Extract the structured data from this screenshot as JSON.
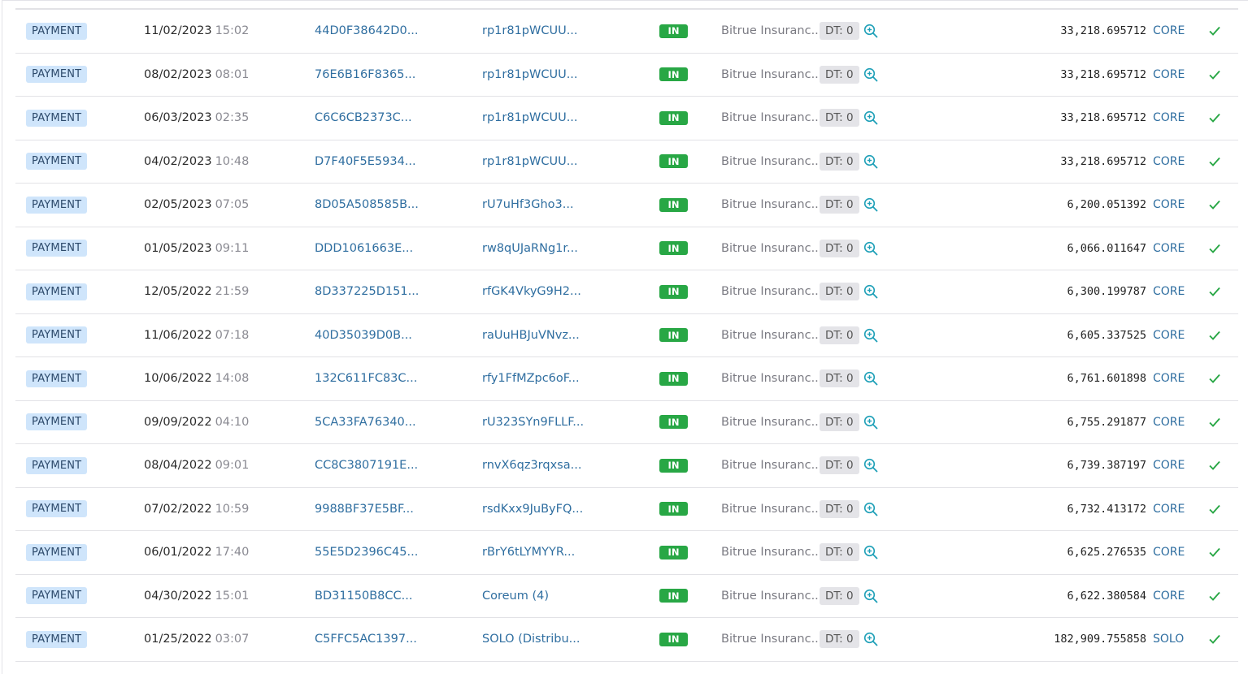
{
  "colors": {
    "type_badge_bg": "#cfe5fb",
    "link": "#2f6ea0",
    "in_badge": "#28a745",
    "dt_badge_bg": "#e4e4e8",
    "zoom_icon": "#1fa0b8",
    "check": "#28a745"
  },
  "rows": [
    {
      "type": "PAYMENT",
      "date": "11/02/2023",
      "time": "15:02",
      "hash": "44D0F38642D0...",
      "account": "rp1r81pWCUU...",
      "direction": "IN",
      "counterparty": "Bitrue Insuranc...",
      "dt": "DT: 0",
      "amount": "33,218.695712",
      "currency": "CORE",
      "status": "success"
    },
    {
      "type": "PAYMENT",
      "date": "08/02/2023",
      "time": "08:01",
      "hash": "76E6B16F8365...",
      "account": "rp1r81pWCUU...",
      "direction": "IN",
      "counterparty": "Bitrue Insuranc...",
      "dt": "DT: 0",
      "amount": "33,218.695712",
      "currency": "CORE",
      "status": "success"
    },
    {
      "type": "PAYMENT",
      "date": "06/03/2023",
      "time": "02:35",
      "hash": "C6C6CB2373C...",
      "account": "rp1r81pWCUU...",
      "direction": "IN",
      "counterparty": "Bitrue Insuranc...",
      "dt": "DT: 0",
      "amount": "33,218.695712",
      "currency": "CORE",
      "status": "success"
    },
    {
      "type": "PAYMENT",
      "date": "04/02/2023",
      "time": "10:48",
      "hash": "D7F40F5E5934...",
      "account": "rp1r81pWCUU...",
      "direction": "IN",
      "counterparty": "Bitrue Insuranc...",
      "dt": "DT: 0",
      "amount": "33,218.695712",
      "currency": "CORE",
      "status": "success"
    },
    {
      "type": "PAYMENT",
      "date": "02/05/2023",
      "time": "07:05",
      "hash": "8D05A508585B...",
      "account": "rU7uHf3Gho3...",
      "direction": "IN",
      "counterparty": "Bitrue Insuranc...",
      "dt": "DT: 0",
      "amount": "6,200.051392",
      "currency": "CORE",
      "status": "success"
    },
    {
      "type": "PAYMENT",
      "date": "01/05/2023",
      "time": "09:11",
      "hash": "DDD1061663E...",
      "account": "rw8qUJaRNg1r...",
      "direction": "IN",
      "counterparty": "Bitrue Insuranc...",
      "dt": "DT: 0",
      "amount": "6,066.011647",
      "currency": "CORE",
      "status": "success"
    },
    {
      "type": "PAYMENT",
      "date": "12/05/2022",
      "time": "21:59",
      "hash": "8D337225D151...",
      "account": "rfGK4VkyG9H2...",
      "direction": "IN",
      "counterparty": "Bitrue Insuranc...",
      "dt": "DT: 0",
      "amount": "6,300.199787",
      "currency": "CORE",
      "status": "success"
    },
    {
      "type": "PAYMENT",
      "date": "11/06/2022",
      "time": "07:18",
      "hash": "40D35039D0B...",
      "account": "raUuHBJuVNvz...",
      "direction": "IN",
      "counterparty": "Bitrue Insuranc...",
      "dt": "DT: 0",
      "amount": "6,605.337525",
      "currency": "CORE",
      "status": "success"
    },
    {
      "type": "PAYMENT",
      "date": "10/06/2022",
      "time": "14:08",
      "hash": "132C611FC83C...",
      "account": "rfy1FfMZpc6oF...",
      "direction": "IN",
      "counterparty": "Bitrue Insuranc...",
      "dt": "DT: 0",
      "amount": "6,761.601898",
      "currency": "CORE",
      "status": "success"
    },
    {
      "type": "PAYMENT",
      "date": "09/09/2022",
      "time": "04:10",
      "hash": "5CA33FA76340...",
      "account": "rU323SYn9FLLF...",
      "direction": "IN",
      "counterparty": "Bitrue Insuranc...",
      "dt": "DT: 0",
      "amount": "6,755.291877",
      "currency": "CORE",
      "status": "success"
    },
    {
      "type": "PAYMENT",
      "date": "08/04/2022",
      "time": "09:01",
      "hash": "CC8C3807191E...",
      "account": "rnvX6qz3rqxsa...",
      "direction": "IN",
      "counterparty": "Bitrue Insuranc...",
      "dt": "DT: 0",
      "amount": "6,739.387197",
      "currency": "CORE",
      "status": "success"
    },
    {
      "type": "PAYMENT",
      "date": "07/02/2022",
      "time": "10:59",
      "hash": "9988BF37E5BF...",
      "account": "rsdKxx9JuByFQ...",
      "direction": "IN",
      "counterparty": "Bitrue Insuranc...",
      "dt": "DT: 0",
      "amount": "6,732.413172",
      "currency": "CORE",
      "status": "success"
    },
    {
      "type": "PAYMENT",
      "date": "06/01/2022",
      "time": "17:40",
      "hash": "55E5D2396C45...",
      "account": "rBrY6tLYMYYR...",
      "direction": "IN",
      "counterparty": "Bitrue Insuranc...",
      "dt": "DT: 0",
      "amount": "6,625.276535",
      "currency": "CORE",
      "status": "success"
    },
    {
      "type": "PAYMENT",
      "date": "04/30/2022",
      "time": "15:01",
      "hash": "BD31150B8CC...",
      "account": "Coreum (4)",
      "direction": "IN",
      "counterparty": "Bitrue Insuranc...",
      "dt": "DT: 0",
      "amount": "6,622.380584",
      "currency": "CORE",
      "status": "success"
    },
    {
      "type": "PAYMENT",
      "date": "01/25/2022",
      "time": "03:07",
      "hash": "C5FFC5AC1397...",
      "account": "SOLO (Distribu...",
      "direction": "IN",
      "counterparty": "Bitrue Insuranc...",
      "dt": "DT: 0",
      "amount": "182,909.755858",
      "currency": "SOLO",
      "status": "success"
    }
  ]
}
